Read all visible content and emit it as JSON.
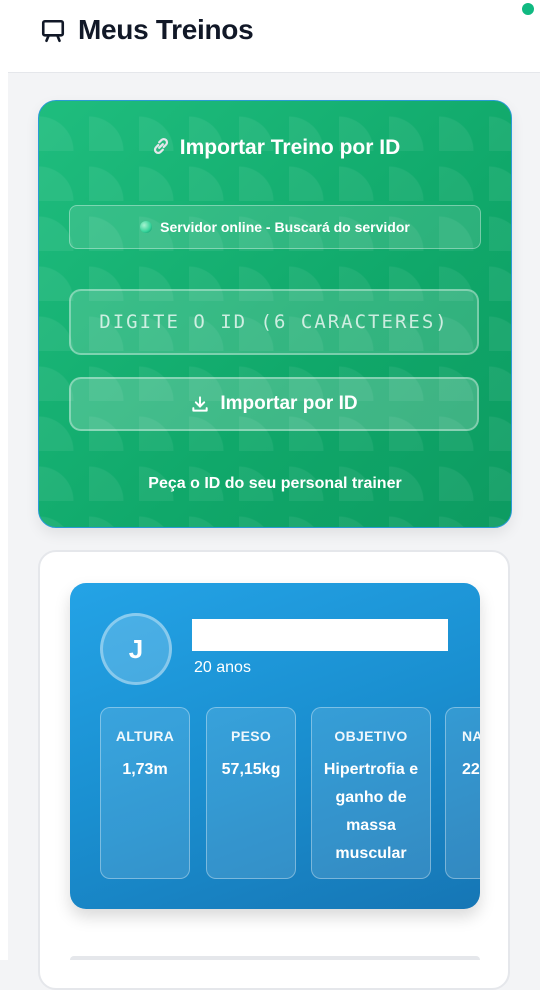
{
  "header": {
    "title": "Meus Treinos",
    "icon": "chat-icon",
    "status_color": "#10b981"
  },
  "import": {
    "title": "Importar Treino por ID",
    "server_status": "Servidor online - Buscará do servidor",
    "input_placeholder": "DIGITE O ID (6 CARACTERES)",
    "input_value": "",
    "button_label": "Importar por ID",
    "hint": "Peça o ID do seu personal trainer"
  },
  "profile": {
    "avatar_initial": "J",
    "age": "20 anos",
    "stats": [
      {
        "label": "ALTURA",
        "value": "1,73m"
      },
      {
        "label": "PESO",
        "value": "57,15kg"
      },
      {
        "label": "OBJETIVO",
        "value": "Hipertrofia e ganho de massa muscular"
      },
      {
        "label": "NA",
        "value": "22"
      }
    ]
  }
}
